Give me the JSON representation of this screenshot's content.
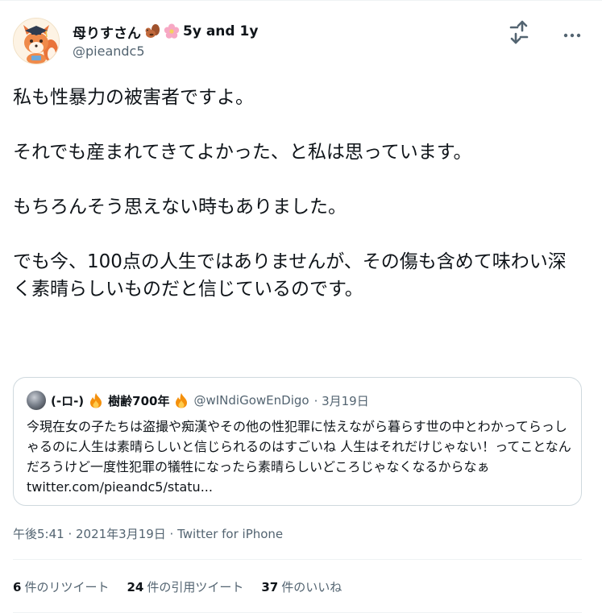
{
  "author": {
    "display_name": "母りすさん",
    "name_suffix": "5y and 1y",
    "handle": "@pieandc5",
    "avatar_icon": "fox-graduate-avatar",
    "name_emojis": [
      "chipmunk-icon",
      "cherry-blossom-icon"
    ]
  },
  "tweet": {
    "paragraphs": [
      "私も性暴力の被害者ですよ。",
      "それでも産まれてきてよかった、と私は思っています。",
      "もちろんそう思えない時もありました。",
      "でも今、100点の人生ではありませんが、その傷も含めて味わい深く素晴らしいものだと信じているのです。"
    ]
  },
  "quoted_tweet": {
    "name_prefix": "(-ロ-)",
    "name_core": "樹齢700年",
    "handle": "@wINdiGowEnDigo",
    "date": "· 3月19日",
    "text": "今現在女の子たちは盗撮や痴漢やその他の性犯罪に怯えながら暮らす世の中とわかってらっしゃるのに人生は素晴らしいと信じられるのはすごいね 人生はそれだけじゃない！ってことなんだろうけど一度性犯罪の犠牲になったら素晴らしいどころじゃなくなるからなぁ twitter.com/pieandc5/statu..."
  },
  "meta": {
    "timestamp": "午後5:41 · 2021年3月19日 · Twitter for iPhone"
  },
  "stats": {
    "retweets": {
      "count": "6",
      "label": "件のリツイート"
    },
    "quotes": {
      "count": "24",
      "label": "件の引用ツイート"
    },
    "likes": {
      "count": "37",
      "label": "件のいいね"
    }
  },
  "colors": {
    "text_primary": "#0f1419",
    "text_secondary": "#536471",
    "border": "#cfd9de",
    "divider": "#eff3f4",
    "fire": "#f4900c"
  }
}
